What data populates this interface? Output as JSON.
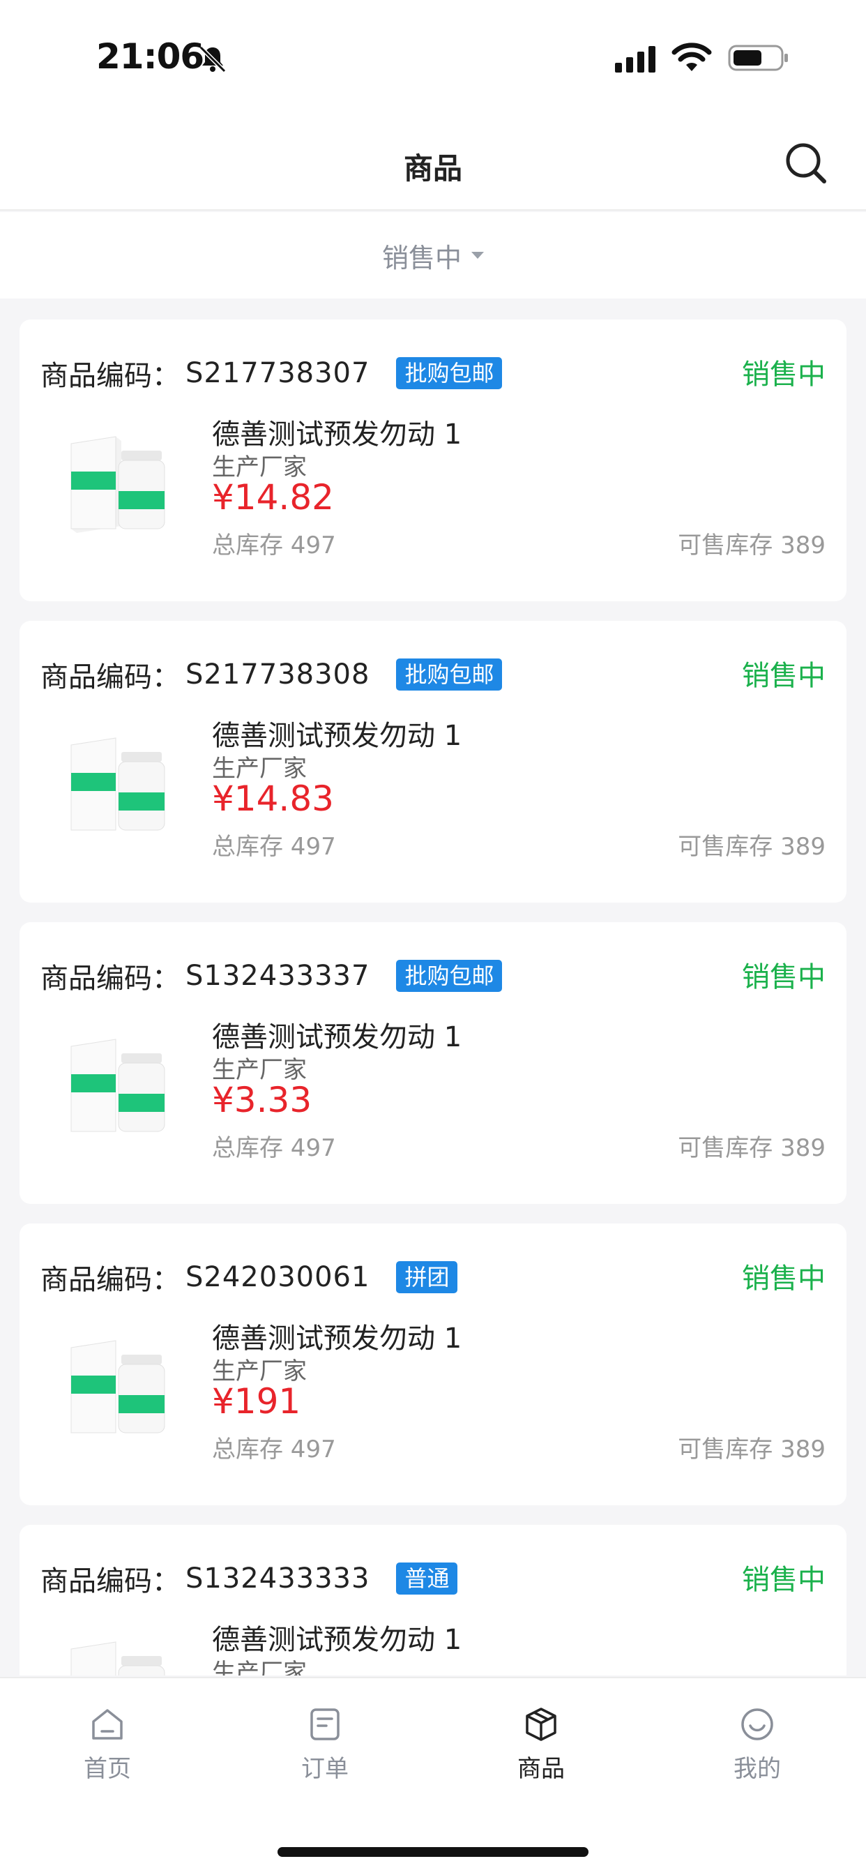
{
  "status": {
    "time": "21:06"
  },
  "header": {
    "title": "商品"
  },
  "filter": {
    "selected": "销售中"
  },
  "products": [
    {
      "code_label": "商品编码：",
      "code": "S217738307",
      "tag": "批购包邮",
      "status": "销售中",
      "name": "德善测试预发勿动 1",
      "maker": "生产厂家",
      "price": "¥14.82",
      "stock_total": "总库存 497",
      "stock_sale": "可售库存 389"
    },
    {
      "code_label": "商品编码：",
      "code": "S217738308",
      "tag": "批购包邮",
      "status": "销售中",
      "name": "德善测试预发勿动 1",
      "maker": "生产厂家",
      "price": "¥14.83",
      "stock_total": "总库存 497",
      "stock_sale": "可售库存 389"
    },
    {
      "code_label": "商品编码：",
      "code": "S132433337",
      "tag": "批购包邮",
      "status": "销售中",
      "name": "德善测试预发勿动 1",
      "maker": "生产厂家",
      "price": "¥3.33",
      "stock_total": "总库存 497",
      "stock_sale": "可售库存 389"
    },
    {
      "code_label": "商品编码：",
      "code": "S242030061",
      "tag": "拼团",
      "status": "销售中",
      "name": "德善测试预发勿动 1",
      "maker": "生产厂家",
      "price": "¥191",
      "stock_total": "总库存 497",
      "stock_sale": "可售库存 389"
    },
    {
      "code_label": "商品编码：",
      "code": "S132433333",
      "tag": "普通",
      "status": "销售中",
      "name": "德善测试预发勿动 1",
      "maker": "生产厂家",
      "price": "",
      "stock_total": "",
      "stock_sale": ""
    }
  ],
  "tabbar": {
    "items": [
      {
        "label": "首页",
        "icon": "home-icon"
      },
      {
        "label": "订单",
        "icon": "order-icon"
      },
      {
        "label": "商品",
        "icon": "product-box-icon"
      },
      {
        "label": "我的",
        "icon": "profile-icon"
      }
    ],
    "active": "商品"
  },
  "colors": {
    "accent_green": "#1bb14c",
    "price_red": "#e8242b",
    "tag_blue": "#1e88e5"
  }
}
